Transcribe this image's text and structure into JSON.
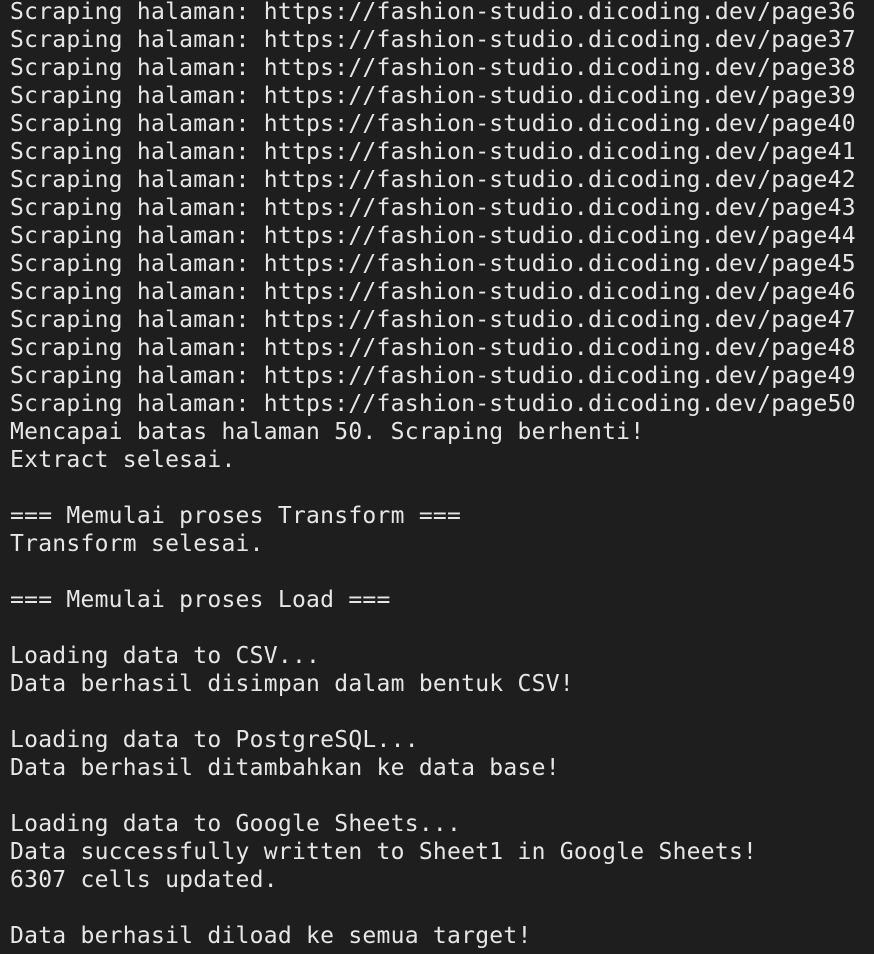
{
  "terminal": {
    "lines": [
      "Scraping halaman: https://fashion-studio.dicoding.dev/page36",
      "Scraping halaman: https://fashion-studio.dicoding.dev/page37",
      "Scraping halaman: https://fashion-studio.dicoding.dev/page38",
      "Scraping halaman: https://fashion-studio.dicoding.dev/page39",
      "Scraping halaman: https://fashion-studio.dicoding.dev/page40",
      "Scraping halaman: https://fashion-studio.dicoding.dev/page41",
      "Scraping halaman: https://fashion-studio.dicoding.dev/page42",
      "Scraping halaman: https://fashion-studio.dicoding.dev/page43",
      "Scraping halaman: https://fashion-studio.dicoding.dev/page44",
      "Scraping halaman: https://fashion-studio.dicoding.dev/page45",
      "Scraping halaman: https://fashion-studio.dicoding.dev/page46",
      "Scraping halaman: https://fashion-studio.dicoding.dev/page47",
      "Scraping halaman: https://fashion-studio.dicoding.dev/page48",
      "Scraping halaman: https://fashion-studio.dicoding.dev/page49",
      "Scraping halaman: https://fashion-studio.dicoding.dev/page50",
      "Mencapai batas halaman 50. Scraping berhenti!",
      "Extract selesai.",
      "",
      "=== Memulai proses Transform ===",
      "Transform selesai.",
      "",
      "=== Memulai proses Load ===",
      "",
      "Loading data to CSV...",
      "Data berhasil disimpan dalam bentuk CSV!",
      "",
      "Loading data to PostgreSQL...",
      "Data berhasil ditambahkan ke data base!",
      "",
      "Loading data to Google Sheets...",
      "Data successfully written to Sheet1 in Google Sheets!",
      "6307 cells updated.",
      "",
      "Data berhasil diload ke semua target!"
    ]
  },
  "colors": {
    "background": "#1e1e1e",
    "text": "#e6e6e6"
  }
}
